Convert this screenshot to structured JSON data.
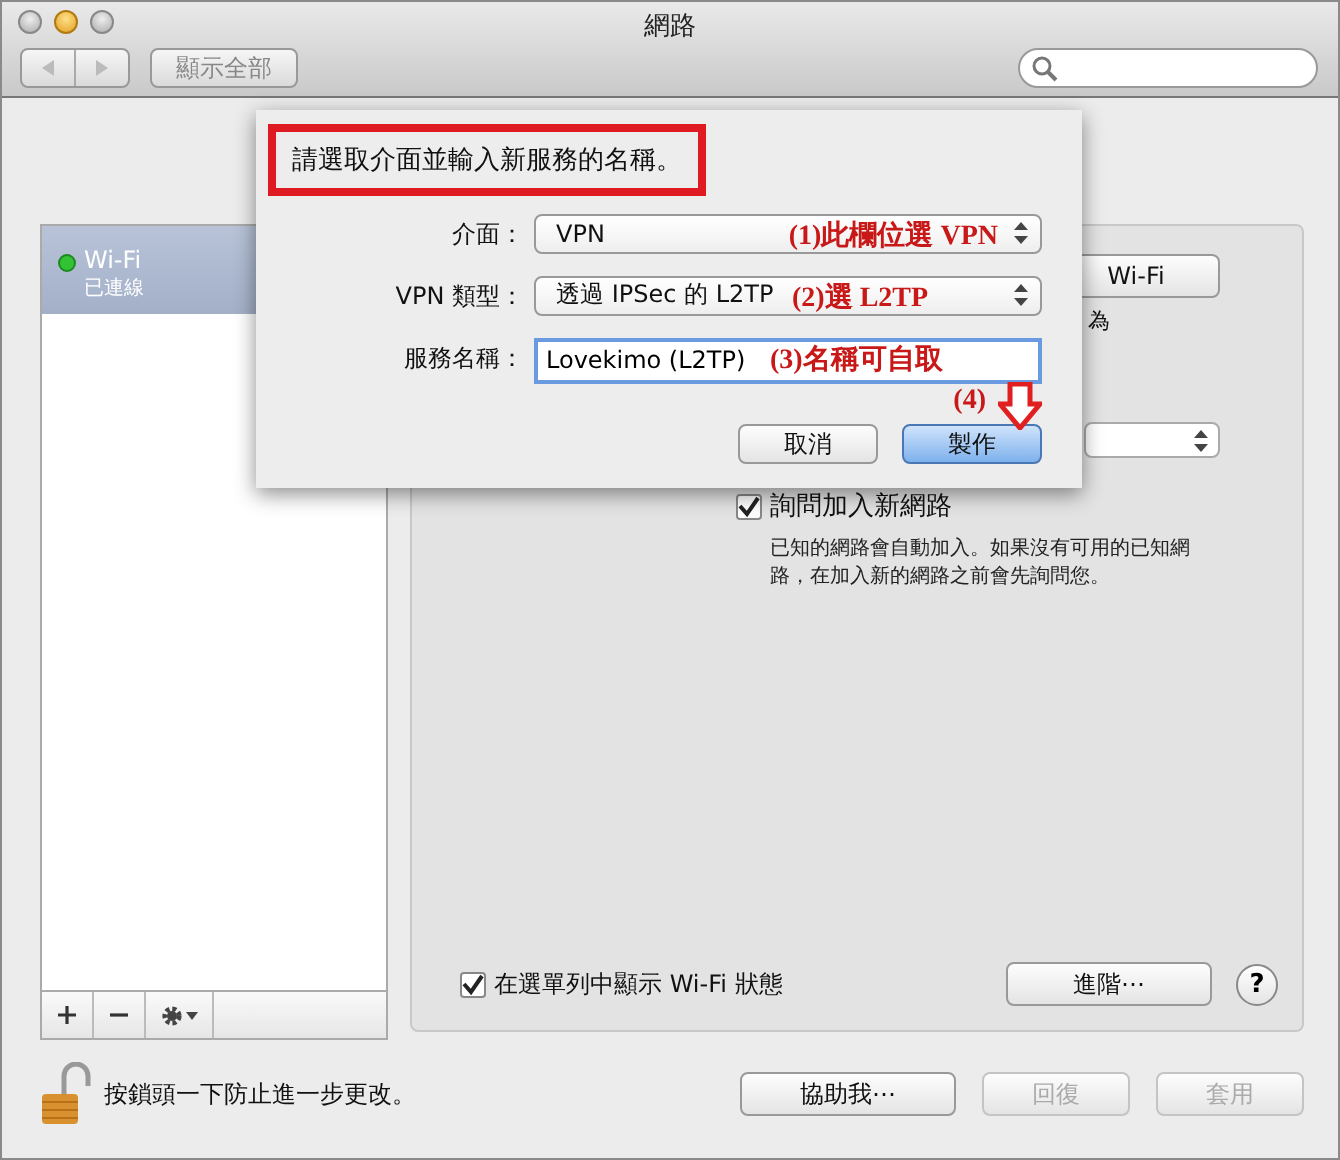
{
  "window": {
    "title": "網路"
  },
  "toolbar": {
    "show_all": "顯示全部"
  },
  "sidebar": {
    "services": [
      {
        "name": "Wi-Fi",
        "status": "已連線",
        "selected": true,
        "connected": true
      }
    ]
  },
  "panel": {
    "wifi_button": "Wi-Fi",
    "partial_text": "為",
    "ask_join": {
      "label": "詢問加入新網路",
      "checked": true
    },
    "ask_join_note": "已知的網路會自動加入。如果沒有可用的已知網路，在加入新的網路之前會先詢問您。",
    "show_status": {
      "label": "在選單列中顯示 Wi-Fi 狀態",
      "checked": true
    },
    "advanced": "進階⋯",
    "help": "?"
  },
  "lock": {
    "text": "按鎖頭一下防止進一步更改。",
    "locked": false
  },
  "footer_buttons": [
    {
      "label": "協助我⋯",
      "disabled": false
    },
    {
      "label": "回復",
      "disabled": true
    },
    {
      "label": "套用",
      "disabled": true
    }
  ],
  "dialog": {
    "prompt": "請選取介面並輸入新服務的名稱。",
    "fields": [
      {
        "kind": "popup",
        "label": "介面：",
        "value": "VPN",
        "annotation": "(1)此欄位選 VPN"
      },
      {
        "kind": "popup",
        "label": "VPN 類型：",
        "value": "透過 IPSec 的 L2TP",
        "annotation": "(2)選 L2TP"
      },
      {
        "kind": "text",
        "label": "服務名稱：",
        "value": "Lovekimo (L2TP)",
        "annotation": "(3)名稱可自取"
      }
    ],
    "buttons": [
      {
        "label": "取消",
        "default": false
      },
      {
        "label": "製作",
        "default": true
      }
    ],
    "step_annotation": "(4)"
  }
}
